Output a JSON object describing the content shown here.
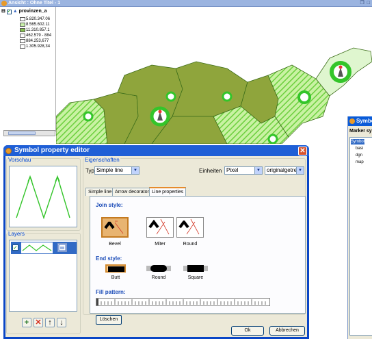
{
  "map_window": {
    "title": "Ansicht : Ohne Titel - 1",
    "toc": {
      "layer_name": "provinzen_a",
      "legend": [
        {
          "label": "5.820.347.06",
          "color": "#ffffff"
        },
        {
          "label": "8.565.602.11",
          "color": "#c8f0a8"
        },
        {
          "label": "11.310.857.1",
          "color": "#86c050"
        },
        {
          "label": "462.579 - 884",
          "color": "#ffffff"
        },
        {
          "label": "884.253,677",
          "color": "#ffffff"
        },
        {
          "label": "1.305.928,34",
          "color": "#ffffff"
        }
      ]
    }
  },
  "marker_panel": {
    "title": "Symbol",
    "label": "Marker sy",
    "tree": [
      "Symbol",
      "basi",
      "dgn",
      "map"
    ]
  },
  "dialog": {
    "title": "Symbol property editor",
    "preview_label": "Vorschau",
    "layers_label": "Layers",
    "properties_label": "Eigenschaften",
    "type_label": "Typ",
    "type_value": "Simple line",
    "units_label": "Einheiten",
    "units_value": "Pixel",
    "scale_value": "originalgetreu",
    "tabs": [
      "Simple line",
      "Arrow decorator",
      "Line properties"
    ],
    "active_tab": 2,
    "join_style_label": "Join style:",
    "join_styles": [
      "Bevel",
      "Miter",
      "Round"
    ],
    "selected_join": "Bevel",
    "end_style_label": "End style:",
    "end_styles": [
      "Butt",
      "Round",
      "Square"
    ],
    "selected_end": "Butt",
    "fill_pattern_label": "Fill pattern:",
    "clear_button": "Löschen",
    "ok_button": "Ok",
    "cancel_button": "Abbrechen",
    "layer_buttons": [
      "add-icon",
      "delete-icon",
      "up-arrow-icon",
      "down-arrow-icon"
    ]
  },
  "colors": {
    "titlebar_blue": "#0a46c6",
    "map_olive": "#8fa53c",
    "map_green_hatch": "#7fd64a",
    "marker_green": "#34c52a",
    "selection": "#316ac5"
  }
}
